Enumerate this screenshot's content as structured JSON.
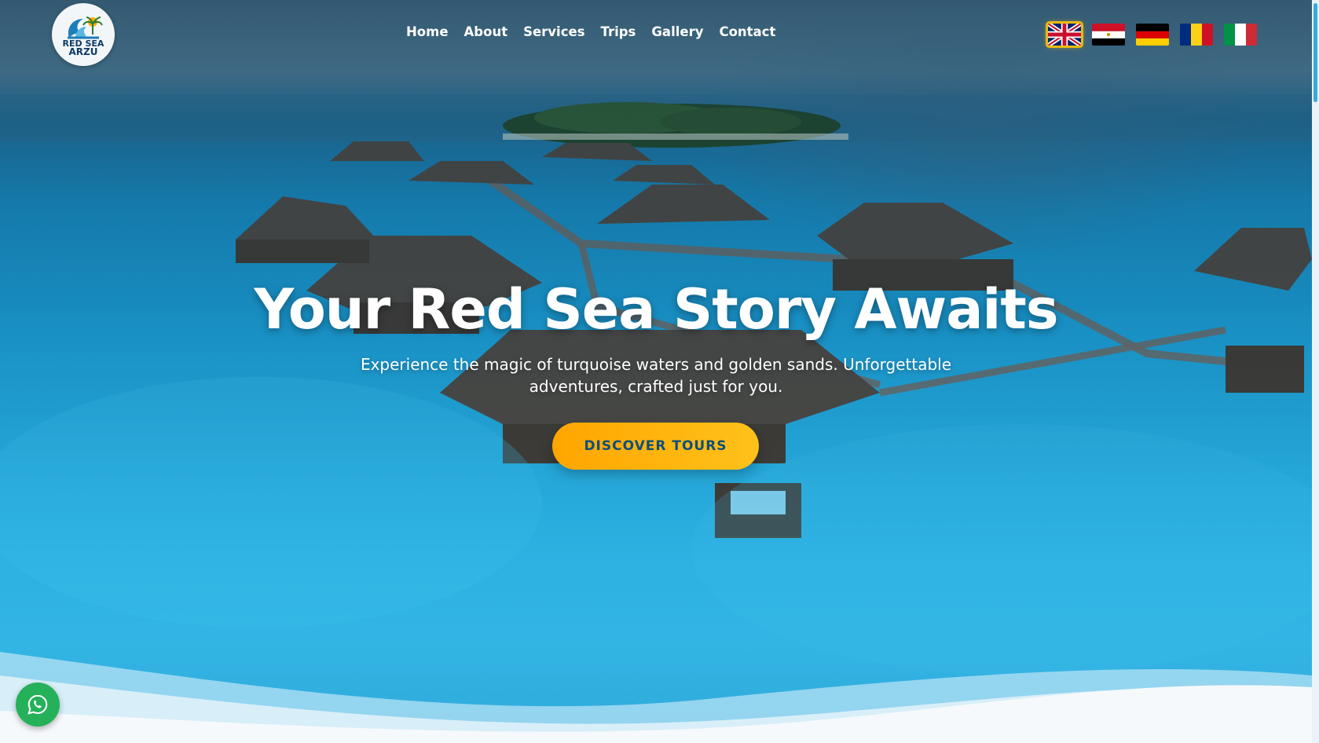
{
  "brand": {
    "logo_line1": "RED SEA",
    "logo_line2": "ARZU"
  },
  "nav": {
    "items": [
      {
        "label": "Home"
      },
      {
        "label": "About"
      },
      {
        "label": "Services"
      },
      {
        "label": "Trips"
      },
      {
        "label": "Gallery"
      },
      {
        "label": "Contact"
      }
    ]
  },
  "languages": [
    {
      "icon": "uk-flag-icon",
      "active": true
    },
    {
      "icon": "egypt-flag-icon",
      "active": false
    },
    {
      "icon": "germany-flag-icon",
      "active": false
    },
    {
      "icon": "romania-flag-icon",
      "active": false
    },
    {
      "icon": "italy-flag-icon",
      "active": false
    }
  ],
  "hero": {
    "title": "Your Red Sea Story Awaits",
    "subtitle": "Experience the magic of turquoise waters and golden sands. Unforgettable adventures, crafted just for you.",
    "cta_label": "DISCOVER TOURS"
  },
  "floating": {
    "icon": "whatsapp-icon"
  },
  "colors": {
    "accent": "#ffb000",
    "cta_text": "#0d4f7a",
    "whatsapp": "#25b15a",
    "sea": "#1b9fd6"
  }
}
